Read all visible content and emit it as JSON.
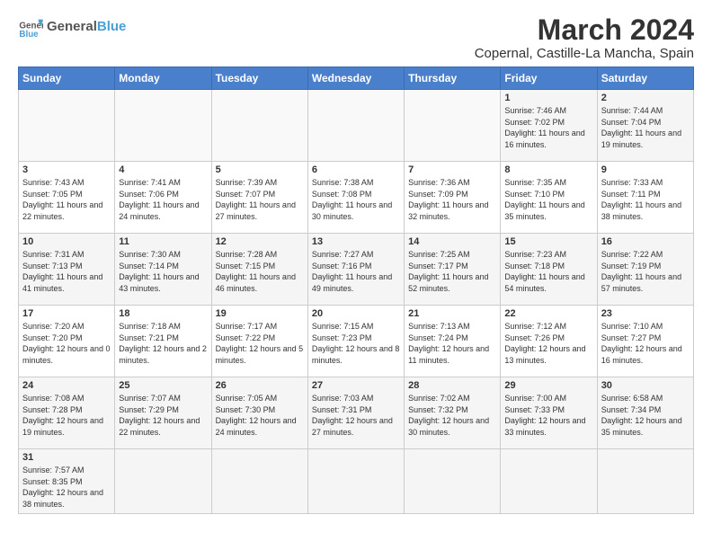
{
  "header": {
    "logo_general": "General",
    "logo_blue": "Blue",
    "title": "March 2024",
    "subtitle": "Copernal, Castille-La Mancha, Spain"
  },
  "days_of_week": [
    "Sunday",
    "Monday",
    "Tuesday",
    "Wednesday",
    "Thursday",
    "Friday",
    "Saturday"
  ],
  "weeks": [
    [
      {
        "day": "",
        "info": ""
      },
      {
        "day": "",
        "info": ""
      },
      {
        "day": "",
        "info": ""
      },
      {
        "day": "",
        "info": ""
      },
      {
        "day": "",
        "info": ""
      },
      {
        "day": "1",
        "info": "Sunrise: 7:46 AM\nSunset: 7:02 PM\nDaylight: 11 hours and 16 minutes."
      },
      {
        "day": "2",
        "info": "Sunrise: 7:44 AM\nSunset: 7:04 PM\nDaylight: 11 hours and 19 minutes."
      }
    ],
    [
      {
        "day": "3",
        "info": "Sunrise: 7:43 AM\nSunset: 7:05 PM\nDaylight: 11 hours and 22 minutes."
      },
      {
        "day": "4",
        "info": "Sunrise: 7:41 AM\nSunset: 7:06 PM\nDaylight: 11 hours and 24 minutes."
      },
      {
        "day": "5",
        "info": "Sunrise: 7:39 AM\nSunset: 7:07 PM\nDaylight: 11 hours and 27 minutes."
      },
      {
        "day": "6",
        "info": "Sunrise: 7:38 AM\nSunset: 7:08 PM\nDaylight: 11 hours and 30 minutes."
      },
      {
        "day": "7",
        "info": "Sunrise: 7:36 AM\nSunset: 7:09 PM\nDaylight: 11 hours and 32 minutes."
      },
      {
        "day": "8",
        "info": "Sunrise: 7:35 AM\nSunset: 7:10 PM\nDaylight: 11 hours and 35 minutes."
      },
      {
        "day": "9",
        "info": "Sunrise: 7:33 AM\nSunset: 7:11 PM\nDaylight: 11 hours and 38 minutes."
      }
    ],
    [
      {
        "day": "10",
        "info": "Sunrise: 7:31 AM\nSunset: 7:13 PM\nDaylight: 11 hours and 41 minutes."
      },
      {
        "day": "11",
        "info": "Sunrise: 7:30 AM\nSunset: 7:14 PM\nDaylight: 11 hours and 43 minutes."
      },
      {
        "day": "12",
        "info": "Sunrise: 7:28 AM\nSunset: 7:15 PM\nDaylight: 11 hours and 46 minutes."
      },
      {
        "day": "13",
        "info": "Sunrise: 7:27 AM\nSunset: 7:16 PM\nDaylight: 11 hours and 49 minutes."
      },
      {
        "day": "14",
        "info": "Sunrise: 7:25 AM\nSunset: 7:17 PM\nDaylight: 11 hours and 52 minutes."
      },
      {
        "day": "15",
        "info": "Sunrise: 7:23 AM\nSunset: 7:18 PM\nDaylight: 11 hours and 54 minutes."
      },
      {
        "day": "16",
        "info": "Sunrise: 7:22 AM\nSunset: 7:19 PM\nDaylight: 11 hours and 57 minutes."
      }
    ],
    [
      {
        "day": "17",
        "info": "Sunrise: 7:20 AM\nSunset: 7:20 PM\nDaylight: 12 hours and 0 minutes."
      },
      {
        "day": "18",
        "info": "Sunrise: 7:18 AM\nSunset: 7:21 PM\nDaylight: 12 hours and 2 minutes."
      },
      {
        "day": "19",
        "info": "Sunrise: 7:17 AM\nSunset: 7:22 PM\nDaylight: 12 hours and 5 minutes."
      },
      {
        "day": "20",
        "info": "Sunrise: 7:15 AM\nSunset: 7:23 PM\nDaylight: 12 hours and 8 minutes."
      },
      {
        "day": "21",
        "info": "Sunrise: 7:13 AM\nSunset: 7:24 PM\nDaylight: 12 hours and 11 minutes."
      },
      {
        "day": "22",
        "info": "Sunrise: 7:12 AM\nSunset: 7:26 PM\nDaylight: 12 hours and 13 minutes."
      },
      {
        "day": "23",
        "info": "Sunrise: 7:10 AM\nSunset: 7:27 PM\nDaylight: 12 hours and 16 minutes."
      }
    ],
    [
      {
        "day": "24",
        "info": "Sunrise: 7:08 AM\nSunset: 7:28 PM\nDaylight: 12 hours and 19 minutes."
      },
      {
        "day": "25",
        "info": "Sunrise: 7:07 AM\nSunset: 7:29 PM\nDaylight: 12 hours and 22 minutes."
      },
      {
        "day": "26",
        "info": "Sunrise: 7:05 AM\nSunset: 7:30 PM\nDaylight: 12 hours and 24 minutes."
      },
      {
        "day": "27",
        "info": "Sunrise: 7:03 AM\nSunset: 7:31 PM\nDaylight: 12 hours and 27 minutes."
      },
      {
        "day": "28",
        "info": "Sunrise: 7:02 AM\nSunset: 7:32 PM\nDaylight: 12 hours and 30 minutes."
      },
      {
        "day": "29",
        "info": "Sunrise: 7:00 AM\nSunset: 7:33 PM\nDaylight: 12 hours and 33 minutes."
      },
      {
        "day": "30",
        "info": "Sunrise: 6:58 AM\nSunset: 7:34 PM\nDaylight: 12 hours and 35 minutes."
      }
    ],
    [
      {
        "day": "31",
        "info": "Sunrise: 7:57 AM\nSunset: 8:35 PM\nDaylight: 12 hours and 38 minutes."
      },
      {
        "day": "",
        "info": ""
      },
      {
        "day": "",
        "info": ""
      },
      {
        "day": "",
        "info": ""
      },
      {
        "day": "",
        "info": ""
      },
      {
        "day": "",
        "info": ""
      },
      {
        "day": "",
        "info": ""
      }
    ]
  ]
}
